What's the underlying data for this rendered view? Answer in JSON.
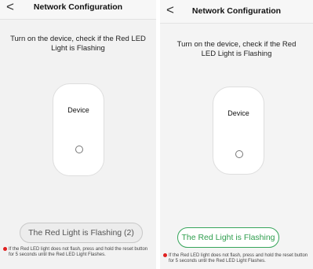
{
  "left": {
    "title": "Network Configuration",
    "back_icon": "<",
    "instruction": "Turn on the device, check if the Red LED Light is Flashing",
    "device_label": "Device",
    "button_label": "The Red Light is Flashing (2)",
    "note": "If the Red LED light does not flash, press and hold the reset button for 5 seconds until the Red LED Light Flashes."
  },
  "right": {
    "title": "Network Configuration",
    "back_icon": "<",
    "instruction": "Turn on the device, check if the Red LED Light is Flashing",
    "device_label": "Device",
    "button_label": "The Red Light is Flashing",
    "note": "If the Red LED light does not flash, press and hold the reset button for 5 seconds until the Red LED Light Flashes."
  },
  "colors": {
    "accent_green": "#2f9e4e",
    "alert_red": "#e02020",
    "disabled_gray": "#ececec"
  }
}
